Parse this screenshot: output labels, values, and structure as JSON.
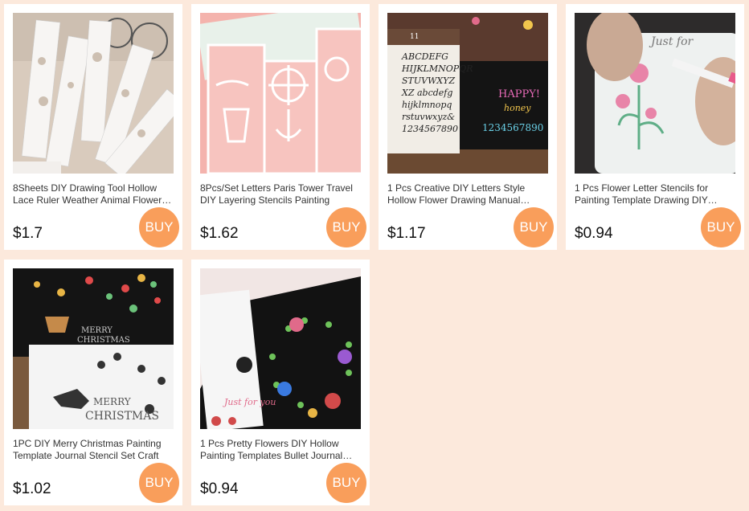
{
  "buy_label": "BUY",
  "products": [
    {
      "title": "8Sheets DIY Drawing Tool Hollow Lace Ruler Weather Animal Flower Stencils",
      "price": "$1.7",
      "image": "bookmark-stencils-photo"
    },
    {
      "title": "8Pcs/Set Letters Paris Tower Travel DIY Layering Stencils Painting",
      "price": "$1.62",
      "image": "pink-stencils-photo"
    },
    {
      "title": "1 Pcs Creative DIY Letters Style Hollow Flower Drawing Manual Template",
      "price": "$1.17",
      "image": "alphabet-stencil-photo"
    },
    {
      "title": "1 Pcs Flower Letter Stencils for Painting Template Drawing DIY Journal",
      "price": "$0.94",
      "image": "flower-stencil-photo"
    },
    {
      "title": "1PC DIY Merry Christmas Painting Template Journal Stencil Set Craft",
      "price": "$1.02",
      "image": "christmas-stencil-photo"
    },
    {
      "title": "1 Pcs Pretty Flowers DIY Hollow Painting Templates Bullet Journal Stencil",
      "price": "$0.94",
      "image": "wreath-stencil-photo"
    }
  ],
  "image_text": {
    "alphabet_lines": [
      "ABCDEFG",
      "HIJKLMNOPQR",
      "STUVWXYZ",
      "XZ abcdefg",
      "hijklmnopq",
      "rstuvwxyz&",
      "1234567890"
    ],
    "alphabet_number": "11",
    "happy": "HAPPY!",
    "honey": "honey",
    "digits": "1234567890",
    "just_for": "Just for",
    "just_for_you": "Just for you",
    "merry": "MERRY",
    "christmas": "CHRISTMAS"
  },
  "colors": {
    "background": "#fce9dc",
    "buy_button": "#f99e5b",
    "card": "#ffffff"
  }
}
